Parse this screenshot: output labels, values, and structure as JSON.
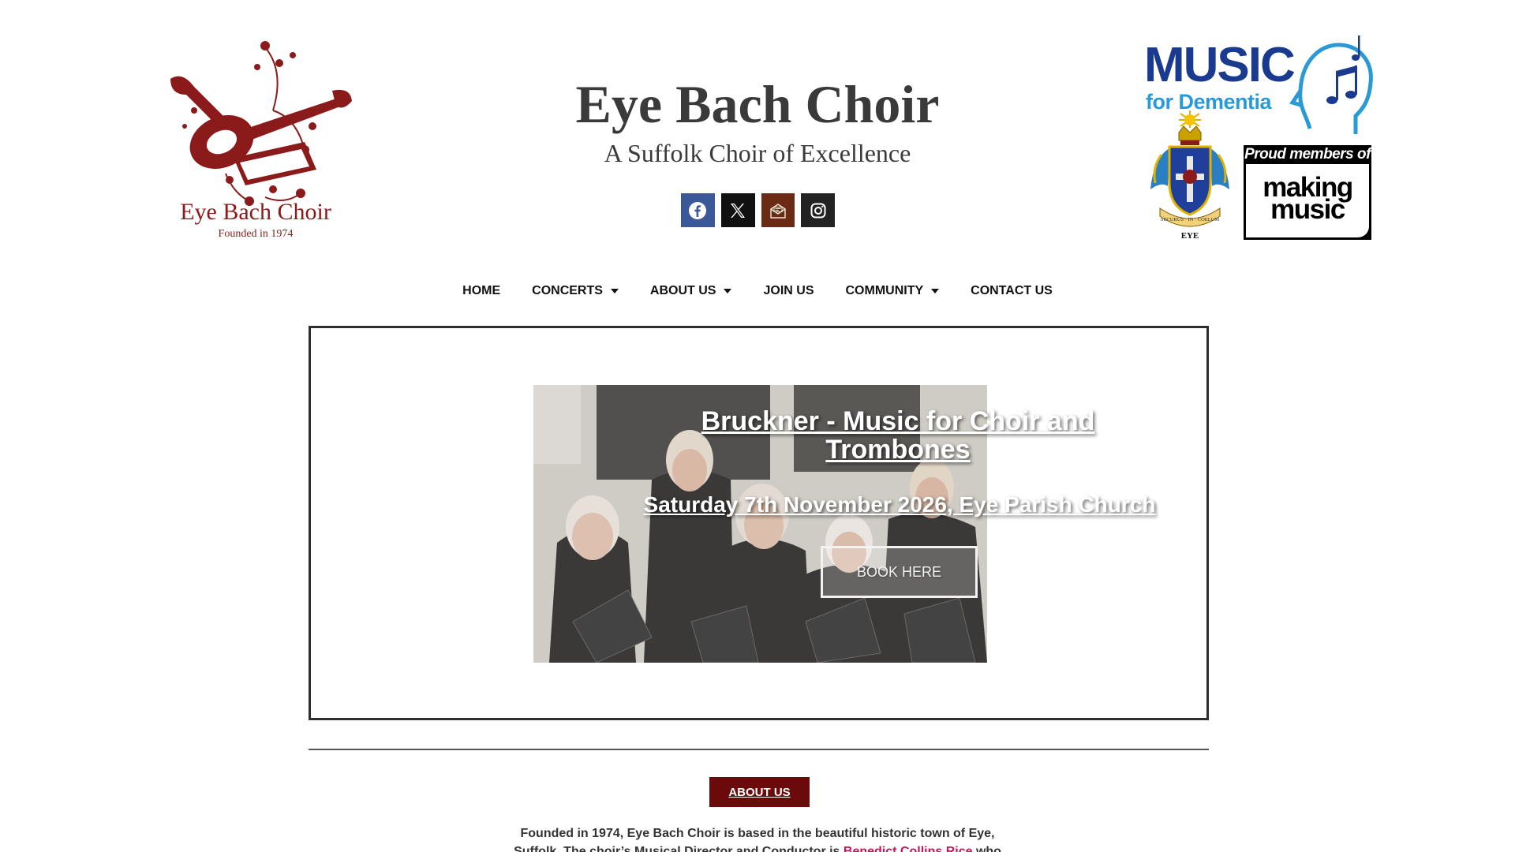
{
  "header": {
    "logo_left": {
      "text": "Eye Bach Choir",
      "subtext": "Founded in 1974"
    },
    "title": "Eye Bach Choir",
    "subtitle": "A Suffolk Choir of Excellence",
    "socials": [
      {
        "name": "facebook",
        "icon": "facebook-icon",
        "color": "#3b5998"
      },
      {
        "name": "x",
        "icon": "x-icon",
        "color": "#111111"
      },
      {
        "name": "email",
        "icon": "mail-icon",
        "color": "#6b2a14"
      },
      {
        "name": "instagram",
        "icon": "instagram-icon",
        "color": "#222222"
      }
    ],
    "partner_logos": {
      "music_for_dementia": {
        "line1": "MUSIC",
        "line2": "for Dementia"
      },
      "crest": {
        "motto": "SECURUS · IN · COELUM",
        "label": "EYE"
      },
      "making_music": {
        "top": "Proud members of",
        "line1": "making",
        "line2": "music"
      }
    }
  },
  "nav": {
    "items": [
      {
        "label": "HOME",
        "dropdown": false
      },
      {
        "label": "CONCERTS",
        "dropdown": true
      },
      {
        "label": "ABOUT US",
        "dropdown": true
      },
      {
        "label": "JOIN US",
        "dropdown": false
      },
      {
        "label": "COMMUNITY",
        "dropdown": true
      },
      {
        "label": "CONTACT US",
        "dropdown": false
      }
    ]
  },
  "hero": {
    "title": "Bruckner - Music for Choir and Trombones",
    "date": "Saturday 7th November 2026, Eye Parish Church",
    "button": "BOOK HERE"
  },
  "about": {
    "button": "ABOUT US",
    "text_line1": "Founded in 1974, Eye Bach Choir is based in the beautiful historic town of Eye,",
    "text_line2_pre": "Suffolk. The choir’s Musical Director and Conductor is ",
    "director_link": "Benedict Collins Rice",
    "text_line2_post": " who"
  },
  "colors": {
    "brand_red": "#8b1a1a",
    "about_button": "#6b0a0a",
    "link": "#c2185b",
    "dementia_blue": "#1a3a8f"
  }
}
